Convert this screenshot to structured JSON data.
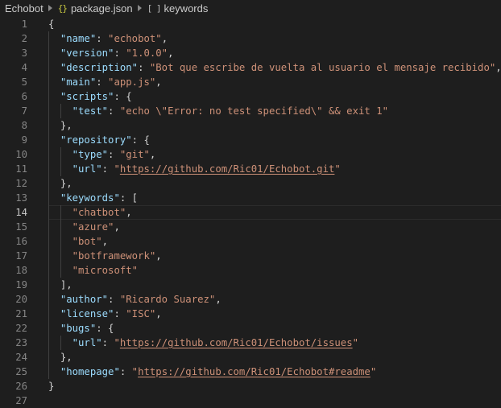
{
  "breadcrumb": {
    "items": [
      {
        "label": "Echobot",
        "icon": null
      },
      {
        "label": "package.json",
        "icon": "json-braces-icon"
      },
      {
        "label": "keywords",
        "icon": "array-brackets-icon"
      }
    ]
  },
  "editor": {
    "current_line": 14,
    "lines": [
      {
        "n": "1",
        "indent": 0,
        "tokens": [
          {
            "t": "p",
            "v": "{"
          }
        ]
      },
      {
        "n": "2",
        "indent": 1,
        "tokens": [
          {
            "t": "k",
            "v": "\"name\""
          },
          {
            "t": "p",
            "v": ": "
          },
          {
            "t": "s",
            "v": "\"echobot\""
          },
          {
            "t": "p",
            "v": ","
          }
        ]
      },
      {
        "n": "3",
        "indent": 1,
        "tokens": [
          {
            "t": "k",
            "v": "\"version\""
          },
          {
            "t": "p",
            "v": ": "
          },
          {
            "t": "s",
            "v": "\"1.0.0\""
          },
          {
            "t": "p",
            "v": ","
          }
        ]
      },
      {
        "n": "4",
        "indent": 1,
        "tokens": [
          {
            "t": "k",
            "v": "\"description\""
          },
          {
            "t": "p",
            "v": ": "
          },
          {
            "t": "s",
            "v": "\"Bot que escribe de vuelta al usuario el mensaje recibido\""
          },
          {
            "t": "p",
            "v": ","
          }
        ]
      },
      {
        "n": "5",
        "indent": 1,
        "tokens": [
          {
            "t": "k",
            "v": "\"main\""
          },
          {
            "t": "p",
            "v": ": "
          },
          {
            "t": "s",
            "v": "\"app.js\""
          },
          {
            "t": "p",
            "v": ","
          }
        ]
      },
      {
        "n": "6",
        "indent": 1,
        "tokens": [
          {
            "t": "k",
            "v": "\"scripts\""
          },
          {
            "t": "p",
            "v": ": {"
          }
        ]
      },
      {
        "n": "7",
        "indent": 2,
        "tokens": [
          {
            "t": "k",
            "v": "\"test\""
          },
          {
            "t": "p",
            "v": ": "
          },
          {
            "t": "s",
            "v": "\"echo \\\"Error: no test specified\\\" && exit 1\""
          }
        ]
      },
      {
        "n": "8",
        "indent": 1,
        "tokens": [
          {
            "t": "p",
            "v": "},"
          }
        ]
      },
      {
        "n": "9",
        "indent": 1,
        "tokens": [
          {
            "t": "k",
            "v": "\"repository\""
          },
          {
            "t": "p",
            "v": ": {"
          }
        ]
      },
      {
        "n": "10",
        "indent": 2,
        "tokens": [
          {
            "t": "k",
            "v": "\"type\""
          },
          {
            "t": "p",
            "v": ": "
          },
          {
            "t": "s",
            "v": "\"git\""
          },
          {
            "t": "p",
            "v": ","
          }
        ]
      },
      {
        "n": "11",
        "indent": 2,
        "tokens": [
          {
            "t": "k",
            "v": "\"url\""
          },
          {
            "t": "p",
            "v": ": "
          },
          {
            "t": "s",
            "v": "\""
          },
          {
            "t": "u",
            "v": "https://github.com/Ric01/Echobot.git"
          },
          {
            "t": "s",
            "v": "\""
          }
        ]
      },
      {
        "n": "12",
        "indent": 1,
        "tokens": [
          {
            "t": "p",
            "v": "},"
          }
        ]
      },
      {
        "n": "13",
        "indent": 1,
        "tokens": [
          {
            "t": "k",
            "v": "\"keywords\""
          },
          {
            "t": "p",
            "v": ": ["
          }
        ]
      },
      {
        "n": "14",
        "indent": 2,
        "tokens": [
          {
            "t": "s",
            "v": "\"chatbot\""
          },
          {
            "t": "p",
            "v": ","
          }
        ]
      },
      {
        "n": "15",
        "indent": 2,
        "tokens": [
          {
            "t": "s",
            "v": "\"azure\""
          },
          {
            "t": "p",
            "v": ","
          }
        ]
      },
      {
        "n": "16",
        "indent": 2,
        "tokens": [
          {
            "t": "s",
            "v": "\"bot\""
          },
          {
            "t": "p",
            "v": ","
          }
        ]
      },
      {
        "n": "17",
        "indent": 2,
        "tokens": [
          {
            "t": "s",
            "v": "\"botframework\""
          },
          {
            "t": "p",
            "v": ","
          }
        ]
      },
      {
        "n": "18",
        "indent": 2,
        "tokens": [
          {
            "t": "s",
            "v": "\"microsoft\""
          }
        ]
      },
      {
        "n": "19",
        "indent": 1,
        "tokens": [
          {
            "t": "p",
            "v": "],"
          }
        ]
      },
      {
        "n": "20",
        "indent": 1,
        "tokens": [
          {
            "t": "k",
            "v": "\"author\""
          },
          {
            "t": "p",
            "v": ": "
          },
          {
            "t": "s",
            "v": "\"Ricardo Suarez\""
          },
          {
            "t": "p",
            "v": ","
          }
        ]
      },
      {
        "n": "21",
        "indent": 1,
        "tokens": [
          {
            "t": "k",
            "v": "\"license\""
          },
          {
            "t": "p",
            "v": ": "
          },
          {
            "t": "s",
            "v": "\"ISC\""
          },
          {
            "t": "p",
            "v": ","
          }
        ]
      },
      {
        "n": "22",
        "indent": 1,
        "tokens": [
          {
            "t": "k",
            "v": "\"bugs\""
          },
          {
            "t": "p",
            "v": ": {"
          }
        ]
      },
      {
        "n": "23",
        "indent": 2,
        "tokens": [
          {
            "t": "k",
            "v": "\"url\""
          },
          {
            "t": "p",
            "v": ": "
          },
          {
            "t": "s",
            "v": "\""
          },
          {
            "t": "u",
            "v": "https://github.com/Ric01/Echobot/issues"
          },
          {
            "t": "s",
            "v": "\""
          }
        ]
      },
      {
        "n": "24",
        "indent": 1,
        "tokens": [
          {
            "t": "p",
            "v": "},"
          }
        ]
      },
      {
        "n": "25",
        "indent": 1,
        "tokens": [
          {
            "t": "k",
            "v": "\"homepage\""
          },
          {
            "t": "p",
            "v": ": "
          },
          {
            "t": "s",
            "v": "\""
          },
          {
            "t": "u",
            "v": "https://github.com/Ric01/Echobot#readme"
          },
          {
            "t": "s",
            "v": "\""
          }
        ]
      },
      {
        "n": "26",
        "indent": 0,
        "tokens": [
          {
            "t": "p",
            "v": "}"
          }
        ]
      },
      {
        "n": "27",
        "indent": 0,
        "tokens": []
      }
    ]
  },
  "colors": {
    "background": "#1e1e1e",
    "key": "#9cdcfe",
    "string": "#ce9178",
    "punctuation": "#d4d4d4",
    "line_number": "#858585",
    "json_icon": "#cbcb41"
  }
}
